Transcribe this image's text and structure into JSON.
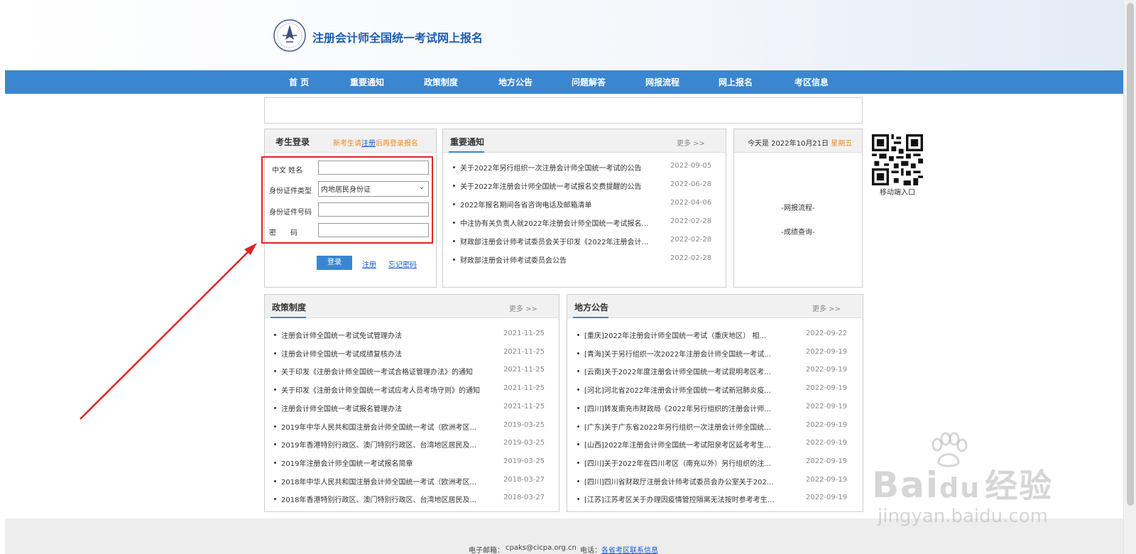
{
  "site": {
    "title": "注册会计师全国统一考试网上报名"
  },
  "nav": [
    "首 页",
    "重要通知",
    "政策制度",
    "地方公告",
    "问题解答",
    "网报流程",
    "网上报名",
    "考区信息"
  ],
  "login": {
    "title": "考生登录",
    "tip_prefix": "新考生请",
    "tip_link": "注册",
    "tip_suffix": "后再登录报名",
    "name_label": "中文 姓名",
    "id_type_label": "身份证件类型",
    "id_type_value": "内地居民身份证",
    "id_number_label": "身份证件号码",
    "password_label": "密　　码",
    "login_button": "登录",
    "register_link": "注册",
    "forgot_link": "忘记密码"
  },
  "notices": {
    "title": "重要通知",
    "more": "更多 >>",
    "items": [
      {
        "title": "关于2022年另行组织一次注册会计师全国统一考试的公告",
        "date": "2022-09-05"
      },
      {
        "title": "关于2022年注册会计师全国统一考试报名交费提醒的公告",
        "date": "2022-06-28"
      },
      {
        "title": "2022年报名期间各省咨询电话及邮箱清单",
        "date": "2022-04-06"
      },
      {
        "title": "中注协有关负责人就2022年注册会计师全国统一考试报名相...",
        "date": "2022-02-28"
      },
      {
        "title": "财政部注册会计师考试委员会关于印发《2022年注册会计师...",
        "date": "2022-02-28"
      },
      {
        "title": "财政部注册会计师考试委员会公告",
        "date": "2022-02-28"
      }
    ]
  },
  "today": {
    "prefix": "今天是 2022年10月21日",
    "weekday": "星期五",
    "link1": "-网报流程-",
    "link2": "-成绩查询-"
  },
  "qr": {
    "label": "移动端入口"
  },
  "policies": {
    "title": "政策制度",
    "more": "更多 >>",
    "items": [
      {
        "title": "注册会计师全国统一考试免试管理办法",
        "date": "2021-11-25"
      },
      {
        "title": "注册会计师全国统一考试成绩复核办法",
        "date": "2021-11-25"
      },
      {
        "title": "关于印发《注册会计师全国统一考试合格证管理办法》的通知",
        "date": "2021-11-25"
      },
      {
        "title": "关于印发《注册会计师全国统一考试应考人员考场守则》的通知",
        "date": "2021-11-25"
      },
      {
        "title": "注册会计师全国统一考试报名管理办法",
        "date": "2021-11-25"
      },
      {
        "title": "2019年中华人民共和国注册会计师全国统一考试（欧洲考区...",
        "date": "2019-03-25"
      },
      {
        "title": "2019年香港特别行政区、澳门特别行政区、台湾地区居民及...",
        "date": "2019-03-25"
      },
      {
        "title": "2019年注册会计师全国统一考试报名简章",
        "date": "2019-03-25"
      },
      {
        "title": "2018年中华人民共和国注册会计师全国统一考试（欧洲考区...",
        "date": "2018-03-27"
      },
      {
        "title": "2018年香港特别行政区、澳门特别行政区、台湾地区居民及...",
        "date": "2018-03-27"
      }
    ]
  },
  "local": {
    "title": "地方公告",
    "more": "更多 >>",
    "items": [
      {
        "title": "[重庆]2022年注册会计师全国统一考试（重庆地区） 相...",
        "date": "2022-09-22"
      },
      {
        "title": "[青海]关于另行组织一次2022年注册会计师全国统一考试...",
        "date": "2022-09-19"
      },
      {
        "title": "[云南]关于2022年度注册会计师全国统一考试昆明考区考...",
        "date": "2022-09-19"
      },
      {
        "title": "[河北]河北省2022年注册会计师全国统一考试新冠肺炎疫...",
        "date": "2022-09-19"
      },
      {
        "title": "[四川]转发南充市财政局《2022年另行组织的注册会计师...",
        "date": "2022-09-19"
      },
      {
        "title": "[广东]关于广东省2022年另行组织一次注册会计师全国统...",
        "date": "2022-09-19"
      },
      {
        "title": "[山西]2022年注册会计师全国统一考试阳泉考区延考考生...",
        "date": "2022-09-19"
      },
      {
        "title": "[四川]关于2022年在四川考区（南充以外）另行组织的注...",
        "date": "2022-09-19"
      },
      {
        "title": "[四川]四川省财政厅注册会计师考试委员会办公室关于202...",
        "date": "2022-09-19"
      },
      {
        "title": "[江苏]江苏考区关于办理因疫情管控隔离无法按时参考考生相...",
        "date": "2022-09-19"
      }
    ]
  },
  "footer": {
    "email_label": "电子邮箱：",
    "email": "cpaks@cicpa.org.cn",
    "phone_label": "电话：",
    "phone_link": "各省考区联系信息"
  },
  "watermark": {
    "brand": "Bai",
    "brand2": "du",
    "brand3": "经验",
    "url": "jingyan.baidu.com"
  },
  "colors": {
    "nav": "#3a86d0",
    "title": "#1b5cb3",
    "highlight": "#e02424",
    "accent": "#f08a1c"
  }
}
